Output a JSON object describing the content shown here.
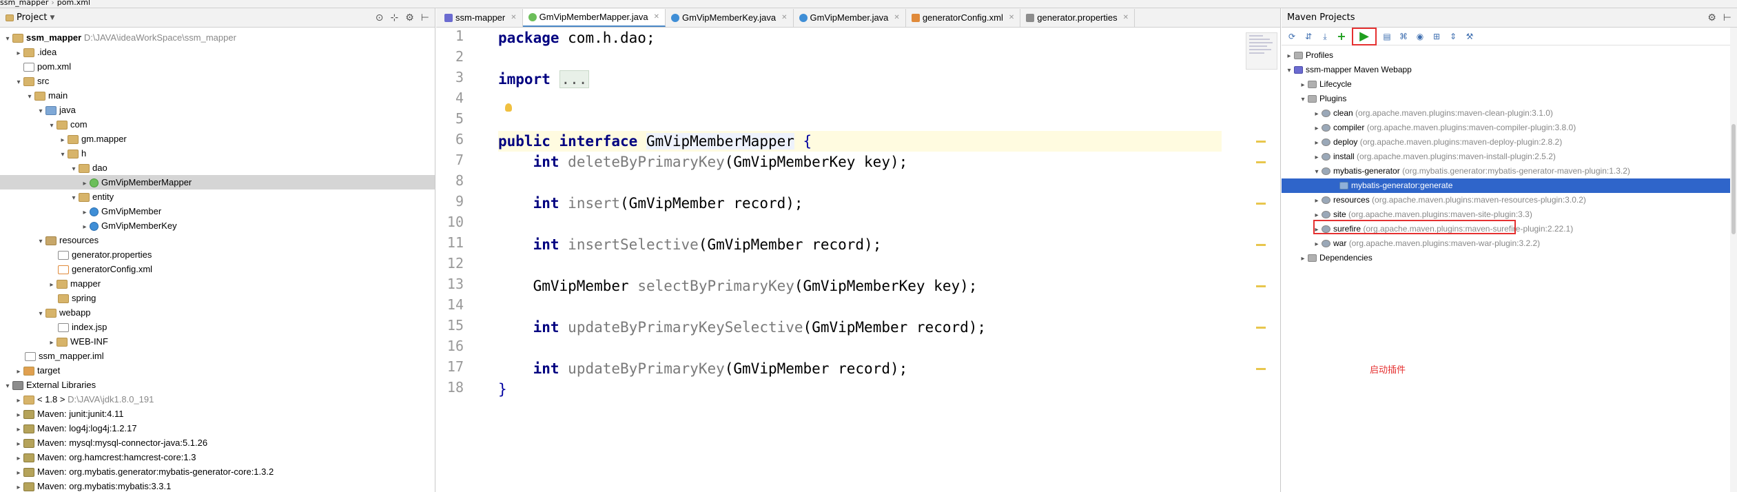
{
  "breadcrumb": [
    "ssm_mapper",
    "pom.xml"
  ],
  "project_panel": {
    "title": "Project",
    "items": [
      {
        "label": "ssm_mapper",
        "path": "D:\\JAVA\\ideaWorkSpace\\ssm_mapper"
      },
      {
        "label": ".idea"
      },
      {
        "label": "pom.xml"
      },
      {
        "label": "src"
      },
      {
        "label": "main"
      },
      {
        "label": "java"
      },
      {
        "label": "com"
      },
      {
        "label": "gm.mapper"
      },
      {
        "label": "h"
      },
      {
        "label": "dao"
      },
      {
        "label": "GmVipMemberMapper"
      },
      {
        "label": "entity"
      },
      {
        "label": "GmVipMember"
      },
      {
        "label": "GmVipMemberKey"
      },
      {
        "label": "resources"
      },
      {
        "label": "generator.properties"
      },
      {
        "label": "generatorConfig.xml"
      },
      {
        "label": "mapper"
      },
      {
        "label": "spring"
      },
      {
        "label": "webapp"
      },
      {
        "label": "index.jsp"
      },
      {
        "label": "WEB-INF"
      },
      {
        "label": "ssm_mapper.iml"
      },
      {
        "label": "target"
      },
      {
        "label": "External Libraries"
      },
      {
        "label": "< 1.8 >",
        "path": "D:\\JAVA\\jdk1.8.0_191"
      },
      {
        "label": "Maven: junit:junit:4.11"
      },
      {
        "label": "Maven: log4j:log4j:1.2.17"
      },
      {
        "label": "Maven: mysql:mysql-connector-java:5.1.26"
      },
      {
        "label": "Maven: org.hamcrest:hamcrest-core:1.3"
      },
      {
        "label": "Maven: org.mybatis.generator:mybatis-generator-core:1.3.2"
      },
      {
        "label": "Maven: org.mybatis:mybatis:3.3.1"
      }
    ]
  },
  "editor": {
    "tabs": [
      {
        "label": "ssm-mapper"
      },
      {
        "label": "GmVipMemberMapper.java"
      },
      {
        "label": "GmVipMemberKey.java"
      },
      {
        "label": "GmVipMember.java"
      },
      {
        "label": "generatorConfig.xml"
      },
      {
        "label": "generator.properties"
      }
    ],
    "line_numbers": [
      "1",
      "2",
      "3",
      "4",
      "5",
      "6",
      "7",
      "8",
      "9",
      "10",
      "11",
      "12",
      "13",
      "14",
      "15",
      "16",
      "17",
      "18"
    ],
    "code": {
      "l1_kw": "package",
      "l1_rest": " com.h.dao;",
      "l3_kw": "import",
      "l3_fold": "...",
      "l6_kw": "public interface",
      "l6_name": "GmVipMemberMapper",
      "l6_brace": " {",
      "l7_kw": "int",
      "l7_method": "deleteByPrimaryKey",
      "l7_args": "(GmVipMemberKey key);",
      "l9_kw": "int",
      "l9_method": "insert",
      "l9_args": "(GmVipMember record);",
      "l11_kw": "int",
      "l11_method": "insertSelective",
      "l11_args": "(GmVipMember record);",
      "l13_type": "GmVipMember",
      "l13_method": "selectByPrimaryKey",
      "l13_args": "(GmVipMemberKey key);",
      "l15_kw": "int",
      "l15_method": "updateByPrimaryKeySelective",
      "l15_args": "(GmVipMember record);",
      "l17_kw": "int",
      "l17_method": "updateByPrimaryKey",
      "l17_args": "(GmVipMember record);",
      "l18": "}"
    }
  },
  "maven_panel": {
    "title": "Maven Projects",
    "items": [
      {
        "label": "Profiles"
      },
      {
        "label": "ssm-mapper Maven Webapp"
      },
      {
        "label": "Lifecycle"
      },
      {
        "label": "Plugins"
      },
      {
        "label": "clean",
        "artifact": "(org.apache.maven.plugins:maven-clean-plugin:3.1.0)"
      },
      {
        "label": "compiler",
        "artifact": "(org.apache.maven.plugins:maven-compiler-plugin:3.8.0)"
      },
      {
        "label": "deploy",
        "artifact": "(org.apache.maven.plugins:maven-deploy-plugin:2.8.2)"
      },
      {
        "label": "install",
        "artifact": "(org.apache.maven.plugins:maven-install-plugin:2.5.2)"
      },
      {
        "label": "mybatis-generator",
        "artifact": "(org.mybatis.generator:mybatis-generator-maven-plugin:1.3.2)"
      },
      {
        "label": "mybatis-generator:generate"
      },
      {
        "label": "resources",
        "artifact": "(org.apache.maven.plugins:maven-resources-plugin:3.0.2)"
      },
      {
        "label": "site",
        "artifact": "(org.apache.maven.plugins:maven-site-plugin:3.3)"
      },
      {
        "label": "surefire",
        "artifact": "(org.apache.maven.plugins:maven-surefire-plugin:2.22.1)"
      },
      {
        "label": "war",
        "artifact": "(org.apache.maven.plugins:maven-war-plugin:3.2.2)"
      },
      {
        "label": "Dependencies"
      }
    ],
    "annotation": "启动插件"
  },
  "colors": {
    "selection": "#2f65ca",
    "highlight_box": "#e53030",
    "keyword": "#000080"
  }
}
